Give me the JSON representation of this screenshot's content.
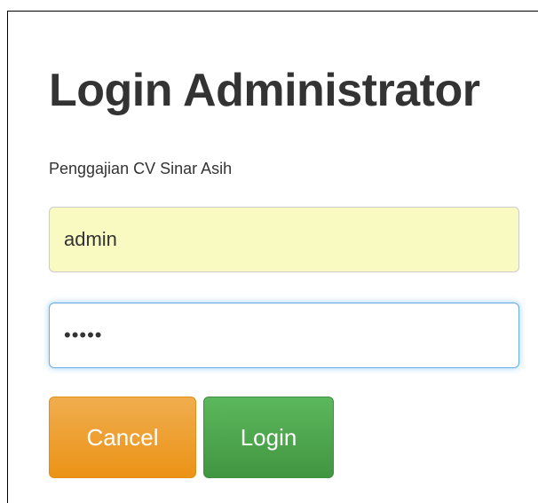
{
  "login": {
    "title": "Login Administrator",
    "subtitle": "Penggajian CV Sinar Asih",
    "username_value": "admin",
    "password_value": "•••••"
  },
  "buttons": {
    "cancel_label": "Cancel",
    "login_label": "Login"
  },
  "colors": {
    "cancel_button": "#f0ad4e",
    "login_button": "#5cb85c",
    "username_field_bg": "#f9f9c2",
    "focus_border": "#66afe9"
  }
}
